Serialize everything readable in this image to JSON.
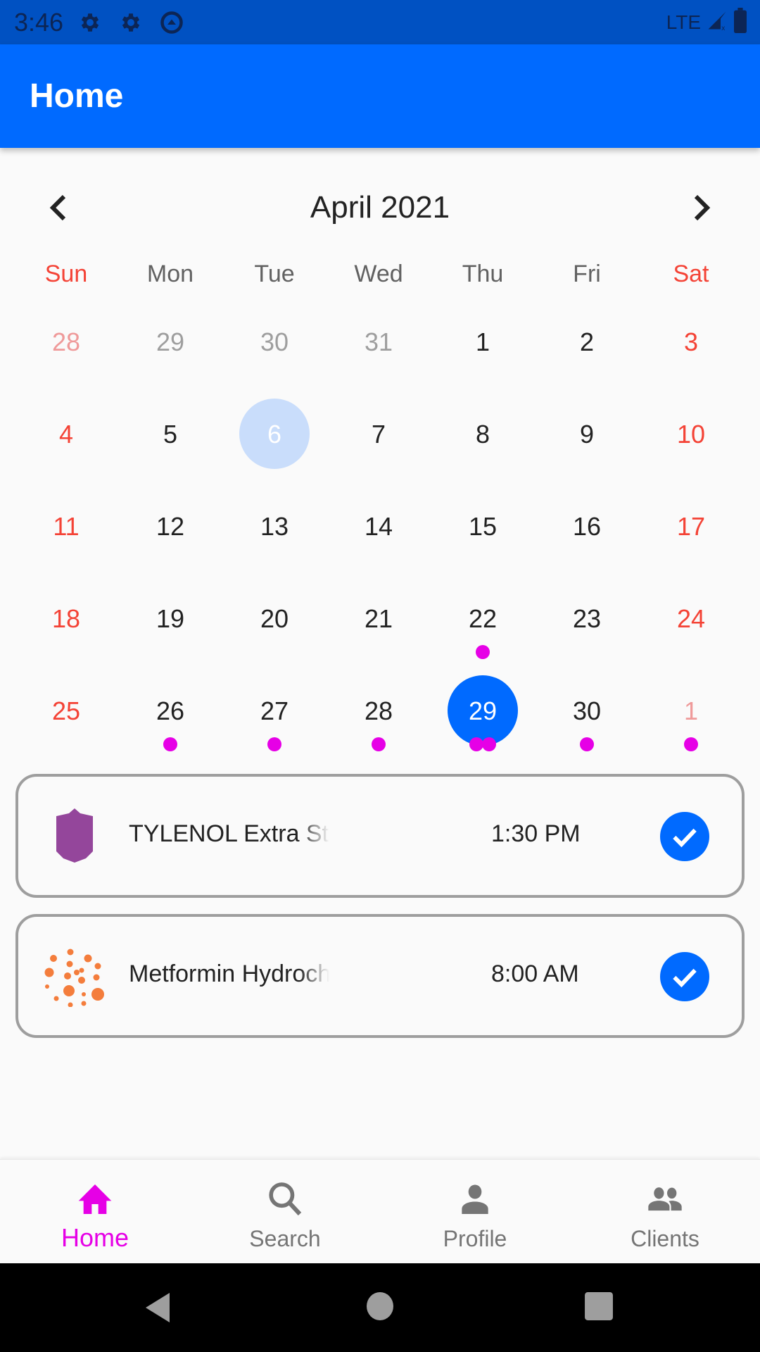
{
  "status_bar": {
    "time": "3:46",
    "icons": [
      "settings-icon",
      "settings-icon",
      "vpn-icon"
    ],
    "network": "LTE",
    "right_icons": [
      "signal-icon",
      "battery-icon"
    ]
  },
  "app_bar": {
    "title": "Home"
  },
  "calendar": {
    "title": "April 2021",
    "prev_label": "previous-month",
    "next_label": "next-month",
    "weekdays": [
      "Sun",
      "Mon",
      "Tue",
      "Wed",
      "Thu",
      "Fri",
      "Sat"
    ],
    "weeks": [
      [
        {
          "d": "28",
          "outside": true
        },
        {
          "d": "29",
          "outside": true
        },
        {
          "d": "30",
          "outside": true
        },
        {
          "d": "31",
          "outside": true
        },
        {
          "d": "1"
        },
        {
          "d": "2"
        },
        {
          "d": "3"
        }
      ],
      [
        {
          "d": "4"
        },
        {
          "d": "5"
        },
        {
          "d": "6",
          "today": true
        },
        {
          "d": "7"
        },
        {
          "d": "8"
        },
        {
          "d": "9"
        },
        {
          "d": "10"
        }
      ],
      [
        {
          "d": "11"
        },
        {
          "d": "12"
        },
        {
          "d": "13"
        },
        {
          "d": "14"
        },
        {
          "d": "15"
        },
        {
          "d": "16"
        },
        {
          "d": "17"
        }
      ],
      [
        {
          "d": "18"
        },
        {
          "d": "19"
        },
        {
          "d": "20"
        },
        {
          "d": "21"
        },
        {
          "d": "22",
          "events": 1
        },
        {
          "d": "23"
        },
        {
          "d": "24"
        }
      ],
      [
        {
          "d": "25"
        },
        {
          "d": "26",
          "events": 1
        },
        {
          "d": "27",
          "events": 1
        },
        {
          "d": "28",
          "events": 1
        },
        {
          "d": "29",
          "selected": true,
          "events": 2
        },
        {
          "d": "30",
          "events": 1
        },
        {
          "d": "1",
          "outside": true,
          "events": 1
        }
      ]
    ],
    "colors": {
      "selected": "#006aff",
      "today": "#c9ddfb",
      "weekend": "#f44336",
      "marker": "#e600e6"
    }
  },
  "medications": [
    {
      "name": "TYLENOL Extra Strength",
      "time": "1:30 PM",
      "icon": "shield-pill-icon",
      "icon_color": "#94469b",
      "taken": true
    },
    {
      "name": "Metformin Hydrochloride",
      "time": "8:00 AM",
      "icon": "dots-pill-icon",
      "icon_color": "#f47d3c",
      "taken": true
    }
  ],
  "bottom_nav": {
    "items": [
      {
        "label": "Home",
        "icon": "home-icon",
        "active": true
      },
      {
        "label": "Search",
        "icon": "search-icon",
        "active": false
      },
      {
        "label": "Profile",
        "icon": "person-icon",
        "active": false
      },
      {
        "label": "Clients",
        "icon": "people-icon",
        "active": false
      }
    ],
    "active_color": "#e600e6"
  },
  "system_nav": [
    "back",
    "home",
    "recents"
  ]
}
